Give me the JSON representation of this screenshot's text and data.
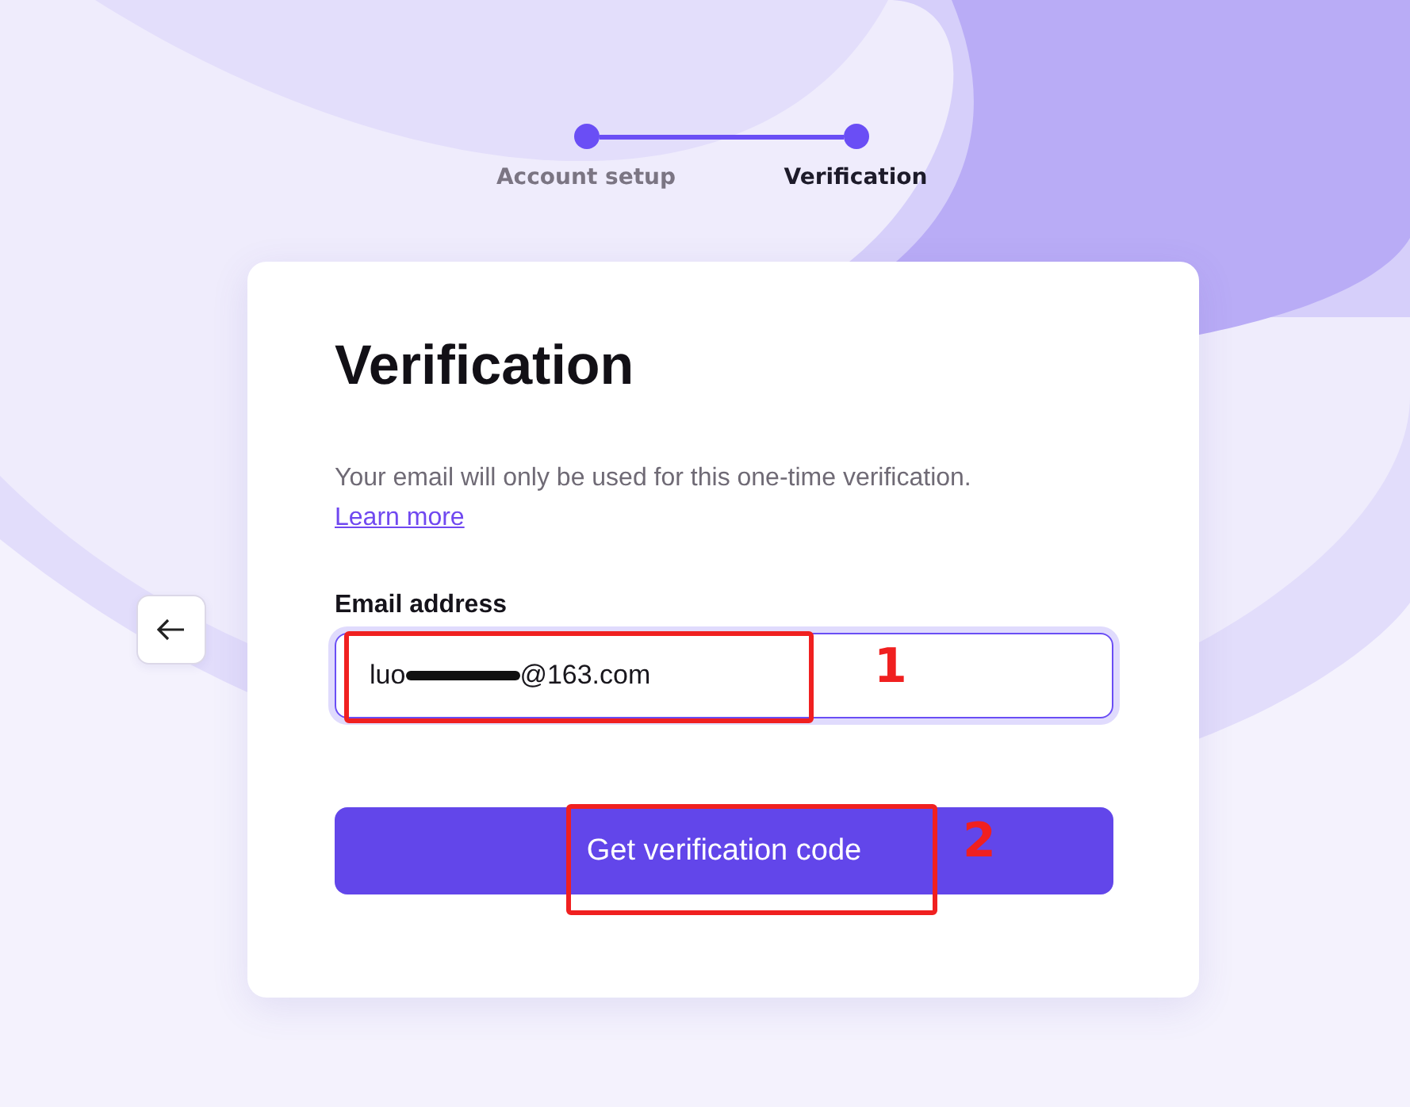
{
  "steps": [
    {
      "label": "Account setup",
      "selected": false
    },
    {
      "label": "Verification",
      "selected": true
    }
  ],
  "card": {
    "title": "Verification",
    "description": "Your email will only be used for this one-time verification.",
    "link": "Learn more",
    "email_field": {
      "label": "Email address",
      "value_start": "luo",
      "value_end": "@163.com",
      "redacted": true,
      "focused": true
    },
    "submit_button": "Get verification code"
  },
  "annotations": [
    {
      "label": "1"
    },
    {
      "label": "2"
    }
  ]
}
